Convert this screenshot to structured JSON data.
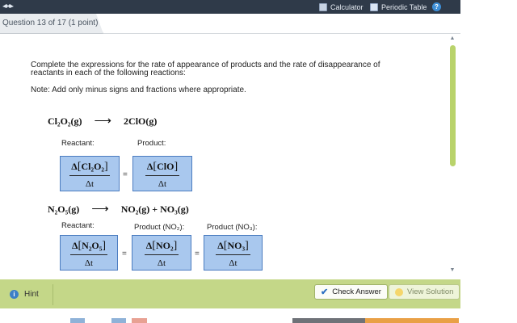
{
  "header": {
    "calculator_label": "Calculator",
    "periodic_table_label": "Periodic Table",
    "help_symbol": "?",
    "colors": {
      "bar": "#2f3a49",
      "accent_green": "#c4d788",
      "answer_box": "#a9c8ee"
    }
  },
  "question_tab": {
    "label": "Question 13 of 17 (1 point)"
  },
  "content": {
    "instructions": "Complete the expressions for the rate of appearance of products and the rate of disappearance of reactants in each of the following reactions:",
    "note": "Note: Add only minus signs and fractions where appropriate.",
    "arrow": "⟶",
    "reaction1": {
      "reactant_label": "Reactant:",
      "product_label": "Product:",
      "reactant_formula": "Cl₂O₂(g)",
      "product_formula": "2ClO(g)",
      "reactant_species": "Cl₂O₂",
      "product_species": "ClO"
    },
    "reaction2": {
      "reactant_label": "Reactant:",
      "product_label_no2": "Product (NO₂):",
      "product_label_no3": "Product (NO₃):",
      "reactant_formula": "N₂O₅(g)",
      "product_formula": "NO₂(g) + NO₃(g)",
      "reactant_species": "N₂O₅",
      "product1_species": "NO₂",
      "product2_species": "NO₃"
    },
    "delta": "Δ",
    "delta_t": "Δt",
    "equals": "="
  },
  "bottom": {
    "hint_label": "Hint",
    "check_answer_label": "Check Answer",
    "view_solution_label": "View Solution"
  }
}
